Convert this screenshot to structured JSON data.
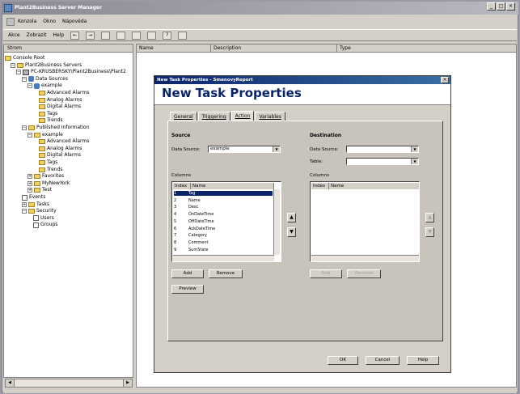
{
  "window": {
    "title": "Plant2Business Server Manager",
    "min": "_",
    "max": "□",
    "close": "×"
  },
  "menubar": {
    "items": [
      "Konzola",
      "Okno",
      "Nápověda"
    ]
  },
  "toolbar": {
    "items": [
      "Akce",
      "Zobrazit",
      "Help"
    ]
  },
  "tree": {
    "header": "Strom",
    "nodes": [
      {
        "label": "Console Root",
        "indent": 0,
        "icon": "folder-icon",
        "expander": ""
      },
      {
        "label": "Plant2Business Servers",
        "indent": 1,
        "icon": "server-icon",
        "expander": "−"
      },
      {
        "label": "PC-KRUSBERSKY\\Plant2Business\\Plant2",
        "indent": 2,
        "icon": "computer-icon",
        "expander": "−"
      },
      {
        "label": "Data Sources",
        "indent": 3,
        "icon": "database-icon",
        "expander": "−"
      },
      {
        "label": "example",
        "indent": 4,
        "icon": "database-icon",
        "expander": "−"
      },
      {
        "label": "Advanced Alarms",
        "indent": 6,
        "icon": "folder-icon",
        "expander": ""
      },
      {
        "label": "Analog Alarms",
        "indent": 6,
        "icon": "folder-icon",
        "expander": ""
      },
      {
        "label": "Digital Alarms",
        "indent": 6,
        "icon": "folder-icon",
        "expander": ""
      },
      {
        "label": "Tags",
        "indent": 6,
        "icon": "folder-icon",
        "expander": ""
      },
      {
        "label": "Trends",
        "indent": 6,
        "icon": "folder-icon",
        "expander": ""
      },
      {
        "label": "Published Information",
        "indent": 3,
        "icon": "publish-icon",
        "expander": "−"
      },
      {
        "label": "example",
        "indent": 4,
        "icon": "folder-icon",
        "expander": "−"
      },
      {
        "label": "Advanced Alarms",
        "indent": 6,
        "icon": "folder-icon",
        "expander": ""
      },
      {
        "label": "Analog Alarms",
        "indent": 6,
        "icon": "folder-icon",
        "expander": ""
      },
      {
        "label": "Digital Alarms",
        "indent": 6,
        "icon": "folder-icon",
        "expander": ""
      },
      {
        "label": "Tags",
        "indent": 6,
        "icon": "folder-icon",
        "expander": ""
      },
      {
        "label": "Trends",
        "indent": 6,
        "icon": "folder-icon",
        "expander": ""
      },
      {
        "label": "Favorites",
        "indent": 4,
        "icon": "folder-icon",
        "expander": "+"
      },
      {
        "label": "MyNewYork",
        "indent": 4,
        "icon": "folder-icon",
        "expander": "+"
      },
      {
        "label": "Test",
        "indent": 4,
        "icon": "folder-icon",
        "expander": "+"
      },
      {
        "label": "Events",
        "indent": 3,
        "icon": "events-icon",
        "expander": ""
      },
      {
        "label": "Tasks",
        "indent": 3,
        "icon": "tasks-icon",
        "expander": "+"
      },
      {
        "label": "Security",
        "indent": 3,
        "icon": "security-icon",
        "expander": "−"
      },
      {
        "label": "Users",
        "indent": 5,
        "icon": "user-icon",
        "expander": ""
      },
      {
        "label": "Groups",
        "indent": 5,
        "icon": "group-icon",
        "expander": ""
      }
    ]
  },
  "listview": {
    "columns": [
      "Name",
      "Description",
      "Type"
    ]
  },
  "dialog": {
    "title": "New Task Properties - SmenovyReport",
    "heading": "New Task Properties",
    "close": "×",
    "tabs": [
      "General",
      "Triggering",
      "Action",
      "Variables"
    ],
    "active_tab": "Action",
    "source": {
      "heading": "Source",
      "datasource_label": "Data Source:",
      "datasource_value": "example",
      "columns_label": "Columns",
      "col_headers": [
        "Index",
        "Name"
      ],
      "rows": [
        {
          "index": "1",
          "name": "Tag"
        },
        {
          "index": "2",
          "name": "Name"
        },
        {
          "index": "3",
          "name": "Desc"
        },
        {
          "index": "4",
          "name": "OnDateTime"
        },
        {
          "index": "5",
          "name": "OffDateTime"
        },
        {
          "index": "6",
          "name": "AckDateTime"
        },
        {
          "index": "7",
          "name": "Category"
        },
        {
          "index": "8",
          "name": "Comment"
        },
        {
          "index": "9",
          "name": "SumState"
        }
      ],
      "add": "Add",
      "remove": "Remove",
      "preview": "Preview"
    },
    "destination": {
      "heading": "Destination",
      "datasource_label": "Data Source:",
      "datasource_value": "",
      "table_label": "Table:",
      "table_value": "",
      "columns_label": "Columns",
      "col_headers": [
        "Index",
        "Name"
      ],
      "add": "Add",
      "remove": "Remove"
    },
    "ok": "OK",
    "cancel": "Cancel",
    "help": "Help"
  }
}
